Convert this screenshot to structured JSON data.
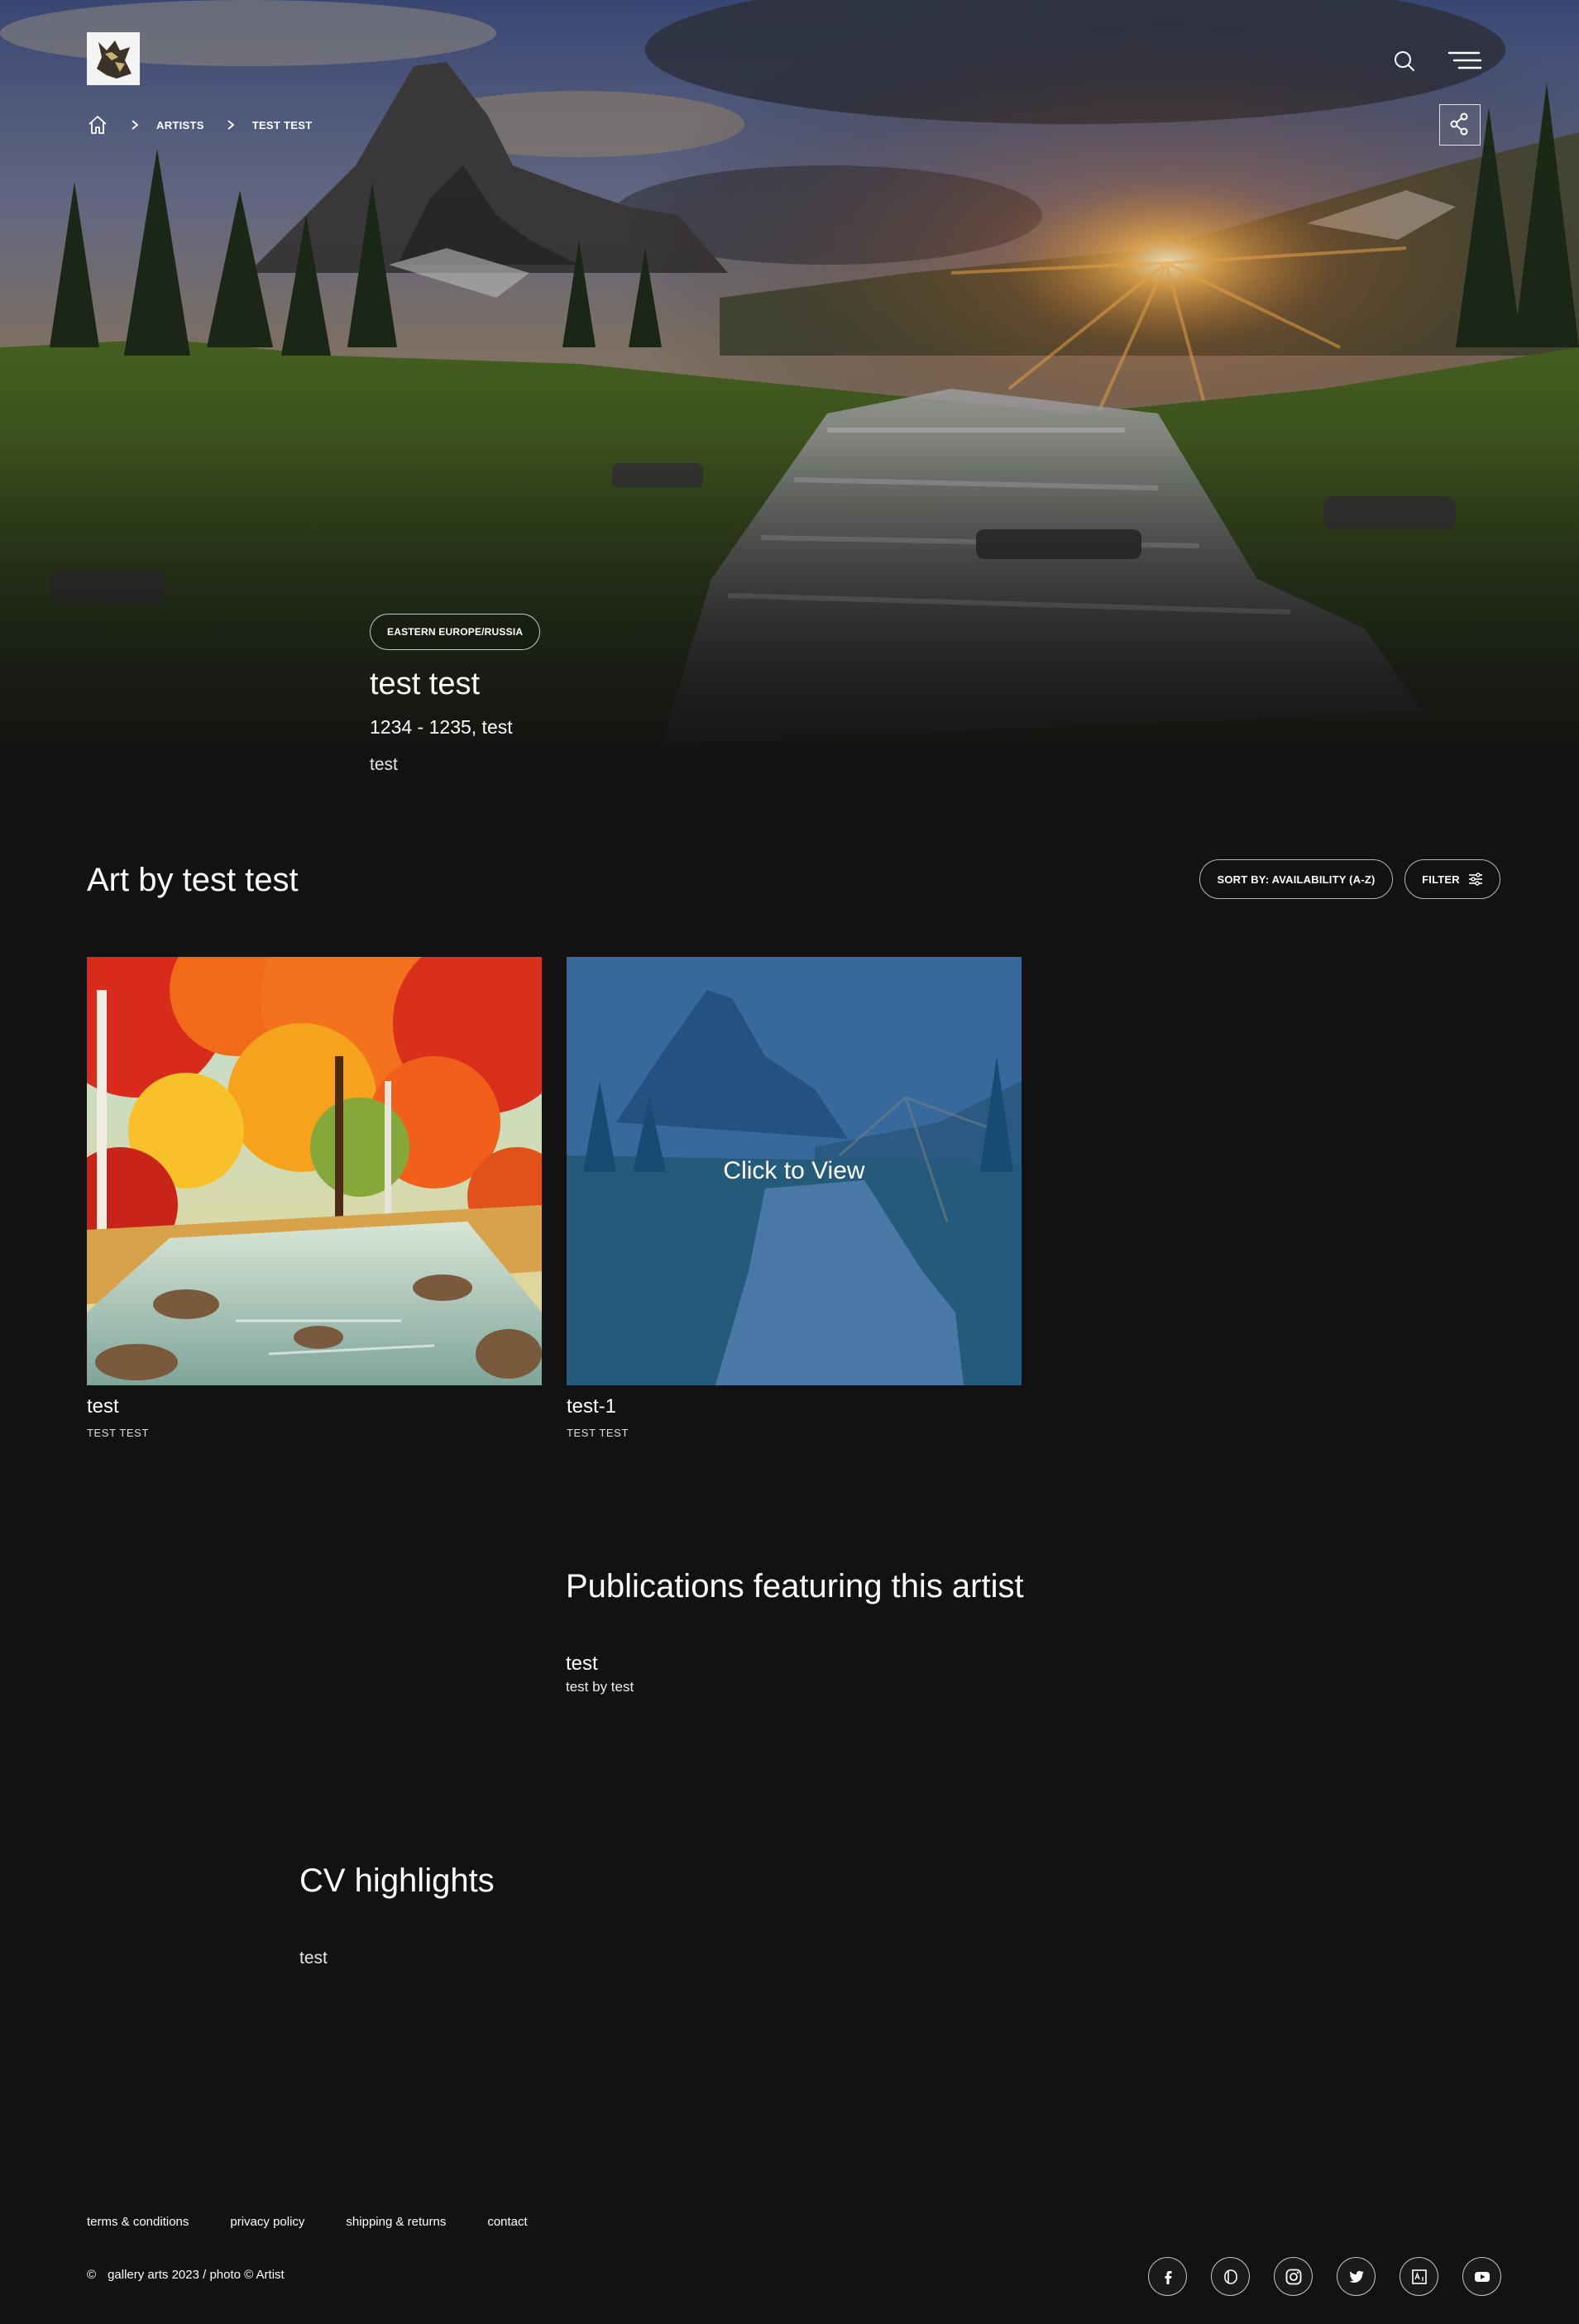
{
  "header": {
    "logo_alt": "gallery arts logo"
  },
  "breadcrumb": {
    "items": [
      "ARTISTS",
      "TEST TEST"
    ]
  },
  "artist": {
    "region": "EASTERN EUROPE/RUSSIA",
    "name": "test test",
    "dates": "1234 - 1235, test",
    "note": "test"
  },
  "art_section": {
    "title": "Art by test test",
    "sort_label": "SORT BY: AVAILABILITY (A-Z)",
    "filter_label": "FILTER",
    "cards": [
      {
        "title": "test",
        "artist": "TEST TEST"
      },
      {
        "title": "test-1",
        "artist": "TEST TEST",
        "overlay": "Click to View"
      }
    ]
  },
  "publications": {
    "title": "Publications featuring this artist",
    "items": [
      {
        "title": "test",
        "subtitle": "test by test"
      }
    ]
  },
  "cv": {
    "title": "CV highlights",
    "text": "test"
  },
  "footer": {
    "links": [
      "terms & conditions",
      "privacy policy",
      "shipping & returns",
      "contact"
    ],
    "copyright_symbol": "©",
    "copyright_text": "gallery arts 2023 / photo © Artist",
    "social": [
      "facebook-icon",
      "dribbble-icon",
      "instagram-icon",
      "twitter-icon",
      "artsy-icon",
      "youtube-icon"
    ]
  },
  "colors": {
    "background": "#121212",
    "overlay_blue": "#1660a8"
  }
}
